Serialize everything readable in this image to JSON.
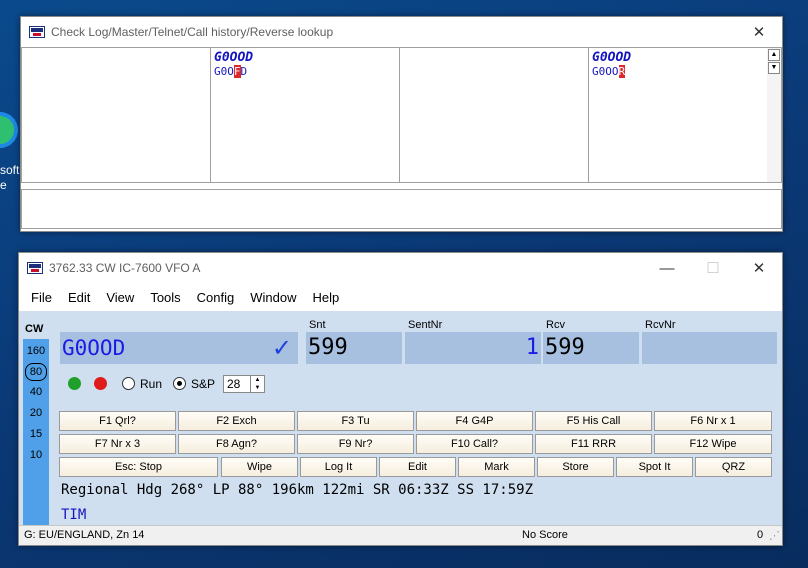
{
  "desktop": {
    "icon_label_1": "soft",
    "icon_label_2": "e"
  },
  "checklog": {
    "title": "Check Log/Master/Telnet/Call history/Reverse lookup",
    "columns": [
      {
        "call": "",
        "partial_pre": "",
        "partial_hl": "",
        "partial_post": ""
      },
      {
        "call": "G0OOD",
        "partial_pre": "G0O",
        "partial_hl": "F",
        "partial_post": "D"
      },
      {
        "call": "",
        "partial_pre": "",
        "partial_hl": "",
        "partial_post": ""
      },
      {
        "call": "G0OOD",
        "partial_pre": "G0OO",
        "partial_hl": "R",
        "partial_post": ""
      }
    ]
  },
  "entry": {
    "title": "3762.33 CW IC-7600 VFO A",
    "menu": [
      "File",
      "Edit",
      "View",
      "Tools",
      "Config",
      "Window",
      "Help"
    ],
    "mode": "CW",
    "bands": [
      "160",
      "80",
      "40",
      "20",
      "15",
      "10"
    ],
    "selected_band": "80",
    "labels": {
      "snt": "Snt",
      "sentnr": "SentNr",
      "rcv": "Rcv",
      "rcvnr": "RcvNr"
    },
    "callsign": "G0OOD",
    "snt": "599",
    "sentnr": "1",
    "rcv": "599",
    "rcvnr": "",
    "radio_run": "Run",
    "radio_sp": "S&P",
    "selected_radio": "S&P",
    "spin_value": "28",
    "fkeys_row1": [
      "F1 Qrl?",
      "F2 Exch",
      "F3 Tu",
      "F4 G4P",
      "F5 His Call",
      "F6 Nr x 1"
    ],
    "fkeys_row2": [
      "F7 Nr x 3",
      "F8 Agn?",
      "F9 Nr?",
      "F10 Call?",
      "F11 RRR",
      "F12 Wipe"
    ],
    "fkeys_row3": [
      "Esc: Stop",
      "Wipe",
      "Log It",
      "Edit",
      "Mark",
      "Store",
      "Spot It",
      "QRZ"
    ],
    "info_line": "Regional Hdg 268° LP 88° 196km 122mi SR 06:33Z SS 17:59Z",
    "name": "TIM",
    "status_left": "G: EU/ENGLAND, Zn 14",
    "status_mid": "No Score",
    "status_right": "0",
    "colors": {
      "green_dot": "#1fa02a",
      "red_dot": "#e01b1b",
      "band_strip": "#4fa0e8",
      "field_bg": "#a7c0e0"
    }
  }
}
